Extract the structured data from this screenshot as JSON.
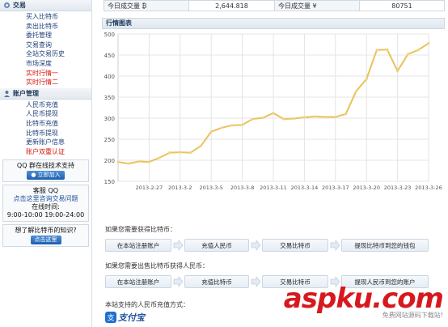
{
  "sidebar": {
    "trade_title": "交易",
    "trade_items": [
      {
        "label": "买入比特币",
        "red": false
      },
      {
        "label": "卖出比特币",
        "red": false
      },
      {
        "label": "委托管理",
        "red": false
      },
      {
        "label": "交易查询",
        "red": false
      },
      {
        "label": "全站交易历史",
        "red": false
      },
      {
        "label": "市场深度",
        "red": false
      },
      {
        "label": "实时行情一",
        "red": true
      },
      {
        "label": "实时行情二",
        "red": true
      }
    ],
    "account_title": "账户管理",
    "account_items": [
      {
        "label": "人民币充值",
        "red": false
      },
      {
        "label": "人民币提现",
        "red": false
      },
      {
        "label": "比特币充值",
        "red": false
      },
      {
        "label": "比特币提现",
        "red": false
      },
      {
        "label": "更新账户信息",
        "red": false
      },
      {
        "label": "账户双重认证",
        "red": true
      }
    ],
    "qq_group": {
      "title": "QQ 群在线技术支持",
      "button": "立即加入"
    },
    "service": {
      "title": "客服 QQ",
      "line1": "点击这里咨询交易问题",
      "line2": "在线时间:",
      "line3": "9:00-10:00 19:00-24:00"
    },
    "learn": {
      "title": "想了解比特币的知识?",
      "button": "点击这里"
    }
  },
  "volume": {
    "label1": "今日成交量 ₿",
    "value1": "2,644.818",
    "label2": "今日成交量 ¥",
    "value2": "80751"
  },
  "chart_panel": {
    "title": "行情图表"
  },
  "chart_data": {
    "type": "line",
    "x": [
      "2013-2-24",
      "2013-2-25",
      "2013-2-26",
      "2013-2-27",
      "2013-2-28",
      "2013-3-1",
      "2013-3-2",
      "2013-3-3",
      "2013-3-4",
      "2013-3-5",
      "2013-3-6",
      "2013-3-7",
      "2013-3-8",
      "2013-3-9",
      "2013-3-10",
      "2013-3-11",
      "2013-3-12",
      "2013-3-13",
      "2013-3-14",
      "2013-3-15",
      "2013-3-16",
      "2013-3-17",
      "2013-3-18",
      "2013-3-19",
      "2013-3-20",
      "2013-3-21",
      "2013-3-22",
      "2013-3-23",
      "2013-3-24",
      "2013-3-25",
      "2013-3-26"
    ],
    "values": [
      196,
      192,
      197,
      196,
      206,
      218,
      219,
      218,
      234,
      268,
      277,
      283,
      284,
      298,
      301,
      312,
      298,
      299,
      302,
      304,
      303,
      303,
      310,
      364,
      393,
      462,
      463,
      412,
      452,
      462,
      478
    ],
    "xticks": [
      "2013-2-27",
      "2013-3-2",
      "2013-3-5",
      "2013-3-8",
      "2013-3-11",
      "2013-3-14",
      "2013-3-17",
      "2013-3-20",
      "2013-3-23",
      "2013-3-26"
    ],
    "yticks": [
      150,
      200,
      250,
      300,
      350,
      400,
      450,
      500
    ],
    "ylim": [
      150,
      500
    ],
    "grid": true,
    "line_color": "#e8c25a",
    "point_color": "#f0d28a"
  },
  "buy_flow": {
    "title": "如果您需要获得比特币：",
    "steps": [
      "在本站注册账户",
      "充值人民币",
      "交易比特币",
      "提现比特币到您的钱包"
    ]
  },
  "sell_flow": {
    "title": "如果您需要出售比特币获得人民币：",
    "steps": [
      "在本站注册账户",
      "充值比特币",
      "交易比特币",
      "提现人民币到您的账户"
    ]
  },
  "payment": {
    "title": "本站支持的人民币充值方式：",
    "alipay": "支付宝"
  },
  "watermark": {
    "main": "aspku.com",
    "sub": "免费网站源码下载站!"
  }
}
